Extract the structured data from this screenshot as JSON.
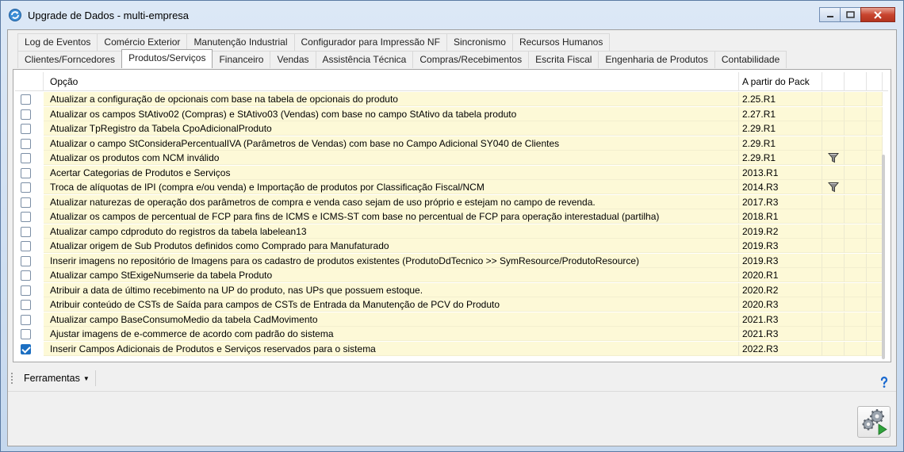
{
  "window": {
    "title": "Upgrade de Dados - multi-empresa"
  },
  "tabs_row1": [
    {
      "label": "Log de Eventos"
    },
    {
      "label": "Comércio Exterior"
    },
    {
      "label": "Manutenção Industrial"
    },
    {
      "label": "Configurador para Impressão NF"
    },
    {
      "label": "Sincronismo"
    },
    {
      "label": "Recursos Humanos"
    }
  ],
  "tabs_row2": [
    {
      "label": "Clientes/Forncedores"
    },
    {
      "label": "Produtos/Serviços",
      "active": true
    },
    {
      "label": "Financeiro"
    },
    {
      "label": "Vendas"
    },
    {
      "label": "Assistência Técnica"
    },
    {
      "label": "Compras/Recebimentos"
    },
    {
      "label": "Escrita Fiscal"
    },
    {
      "label": "Engenharia de Produtos"
    },
    {
      "label": "Contabilidade"
    }
  ],
  "grid": {
    "columns": {
      "option": "Opção",
      "pack": "A partir do Pack"
    },
    "rows": [
      {
        "checked": false,
        "option": "Atualizar a configuração de opcionais com base na tabela de opcionais do produto",
        "pack": "2.25.R1",
        "filter": false
      },
      {
        "checked": false,
        "option": "Atualizar os campos StAtivo02 (Compras) e StAtivo03 (Vendas) com base no campo StAtivo da tabela produto",
        "pack": "2.27.R1",
        "filter": false
      },
      {
        "checked": false,
        "option": "Atualizar TpRegistro da Tabela CpoAdicionalProduto",
        "pack": "2.29.R1",
        "filter": false
      },
      {
        "checked": false,
        "option": "Atualizar o campo StConsideraPercentualIVA (Parâmetros de Vendas) com base no Campo Adicional SY040 de Clientes",
        "pack": "2.29.R1",
        "filter": false
      },
      {
        "checked": false,
        "option": "Atualizar os produtos com NCM inválido",
        "pack": "2.29.R1",
        "filter": true
      },
      {
        "checked": false,
        "option": "Acertar Categorias de Produtos e Serviços",
        "pack": "2013.R1",
        "filter": false
      },
      {
        "checked": false,
        "option": "Troca de alíquotas de IPI (compra e/ou venda) e Importação de produtos por Classificação Fiscal/NCM",
        "pack": "2014.R3",
        "filter": true
      },
      {
        "checked": false,
        "option": "Atualizar naturezas de operação dos parâmetros de compra e venda caso sejam de uso próprio e estejam no campo de revenda.",
        "pack": "2017.R3",
        "filter": false
      },
      {
        "checked": false,
        "option": "Atualizar os campos de percentual de FCP para fins de ICMS e ICMS-ST com base no percentual de FCP para operação interestadual (partilha)",
        "pack": "2018.R1",
        "filter": false
      },
      {
        "checked": false,
        "option": "Atualizar campo cdproduto do registros da tabela labelean13",
        "pack": "2019.R2",
        "filter": false
      },
      {
        "checked": false,
        "option": "Atualizar origem de Sub Produtos definidos como Comprado para Manufaturado",
        "pack": "2019.R3",
        "filter": false
      },
      {
        "checked": false,
        "option": "Inserir imagens no repositório de Imagens para os cadastro de produtos existentes (ProdutoDdTecnico >> SymResource/ProdutoResource)",
        "pack": "2019.R3",
        "filter": false
      },
      {
        "checked": false,
        "option": "Atualizar campo StExigeNumserie da tabela Produto",
        "pack": "2020.R1",
        "filter": false
      },
      {
        "checked": false,
        "option": "Atribuir a data de último recebimento na UP do produto, nas UPs que possuem estoque.",
        "pack": "2020.R2",
        "filter": false
      },
      {
        "checked": false,
        "option": "Atribuir conteúdo de CSTs de Saída para campos de CSTs de Entrada da Manutenção de PCV do Produto",
        "pack": "2020.R3",
        "filter": false
      },
      {
        "checked": false,
        "option": "Atualizar campo BaseConsumoMedio da tabela CadMovimento",
        "pack": "2021.R3",
        "filter": false
      },
      {
        "checked": false,
        "option": "Ajustar imagens de e-commerce de acordo com padrão do sistema",
        "pack": "2021.R3",
        "filter": false
      },
      {
        "checked": true,
        "option": "Inserir Campos Adicionais de Produtos e Serviços reservados para o sistema",
        "pack": "2022.R3",
        "filter": false
      }
    ]
  },
  "toolbar": {
    "tools_label": "Ferramentas",
    "help_glyph": "ʔ"
  },
  "icons": {
    "app": "refresh-icon",
    "filter": "filter-icon",
    "help": "help-icon",
    "execute": "gears-run-icon"
  },
  "colors": {
    "row_highlight": "#fdf9d7",
    "checkbox_checked": "#1c6fc2",
    "close_button": "#c8452f"
  }
}
